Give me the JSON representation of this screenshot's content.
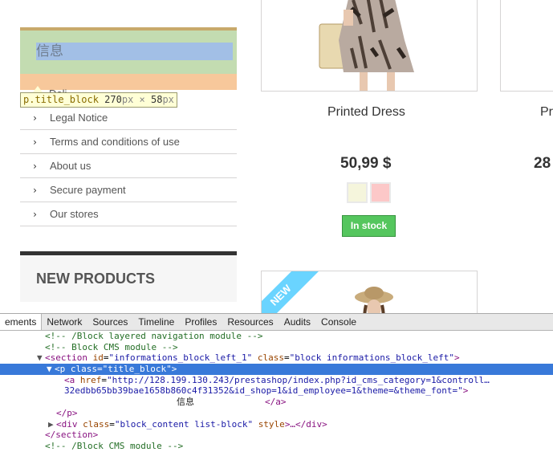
{
  "sidebar": {
    "title": "信息",
    "partial_item": "Deli",
    "tooltip": {
      "selector": "p.title_block",
      "width": "270",
      "height": "58",
      "unit": "px",
      "times": "×"
    },
    "items": [
      {
        "label": "Legal Notice"
      },
      {
        "label": "Terms and conditions of use"
      },
      {
        "label": "About us"
      },
      {
        "label": "Secure payment"
      },
      {
        "label": "Our stores"
      }
    ],
    "new_products": "NEW PRODUCTS"
  },
  "product": {
    "name": "Printed Dress",
    "price": "50,99 $",
    "stock": "In stock",
    "swatch_colors": [
      "#f5f5dc",
      "#fcc8c8"
    ],
    "badge": "NEW"
  },
  "product2": {
    "name_partial": "Pr",
    "price_partial": "28"
  },
  "devtools": {
    "tabs": [
      "ements",
      "Network",
      "Sources",
      "Timeline",
      "Profiles",
      "Resources",
      "Audits",
      "Console"
    ],
    "lines": {
      "l1": "<!-- /Block layered navigation module -->",
      "l2": "<!-- Block CMS module -->",
      "l3_tag_open": "<section",
      "l3_attr1": "id",
      "l3_val1": "\"informations_block_left_1\"",
      "l3_attr2": "class",
      "l3_val2": "\"block informations_block_left\"",
      "l3_close": ">",
      "l4_tag": "<p",
      "l4_attr": "class",
      "l4_val": "\"title_block\"",
      "l4_close": ">",
      "l5_tag": "<a",
      "l5_attr": "href",
      "l5_val": "\"http://128.199.130.243/prestashop/index.php?id_cms_category=1&controll…",
      "l6_val": "32edbb65bb39bae1658b860c4f31352&id_shop=1&id_employee=1&theme=&theme_font=\"",
      "l6_close": ">",
      "l7_text": "信息",
      "l7_close": "</a>",
      "l8": "</p>",
      "l9_tag": "<div",
      "l9_attr1": "class",
      "l9_val1": "\"block_content list-block\"",
      "l9_attr2": "style",
      "l9_rest": ">…</div>",
      "l10": "</section>",
      "l11": "<!-- /Block CMS module -->"
    }
  }
}
